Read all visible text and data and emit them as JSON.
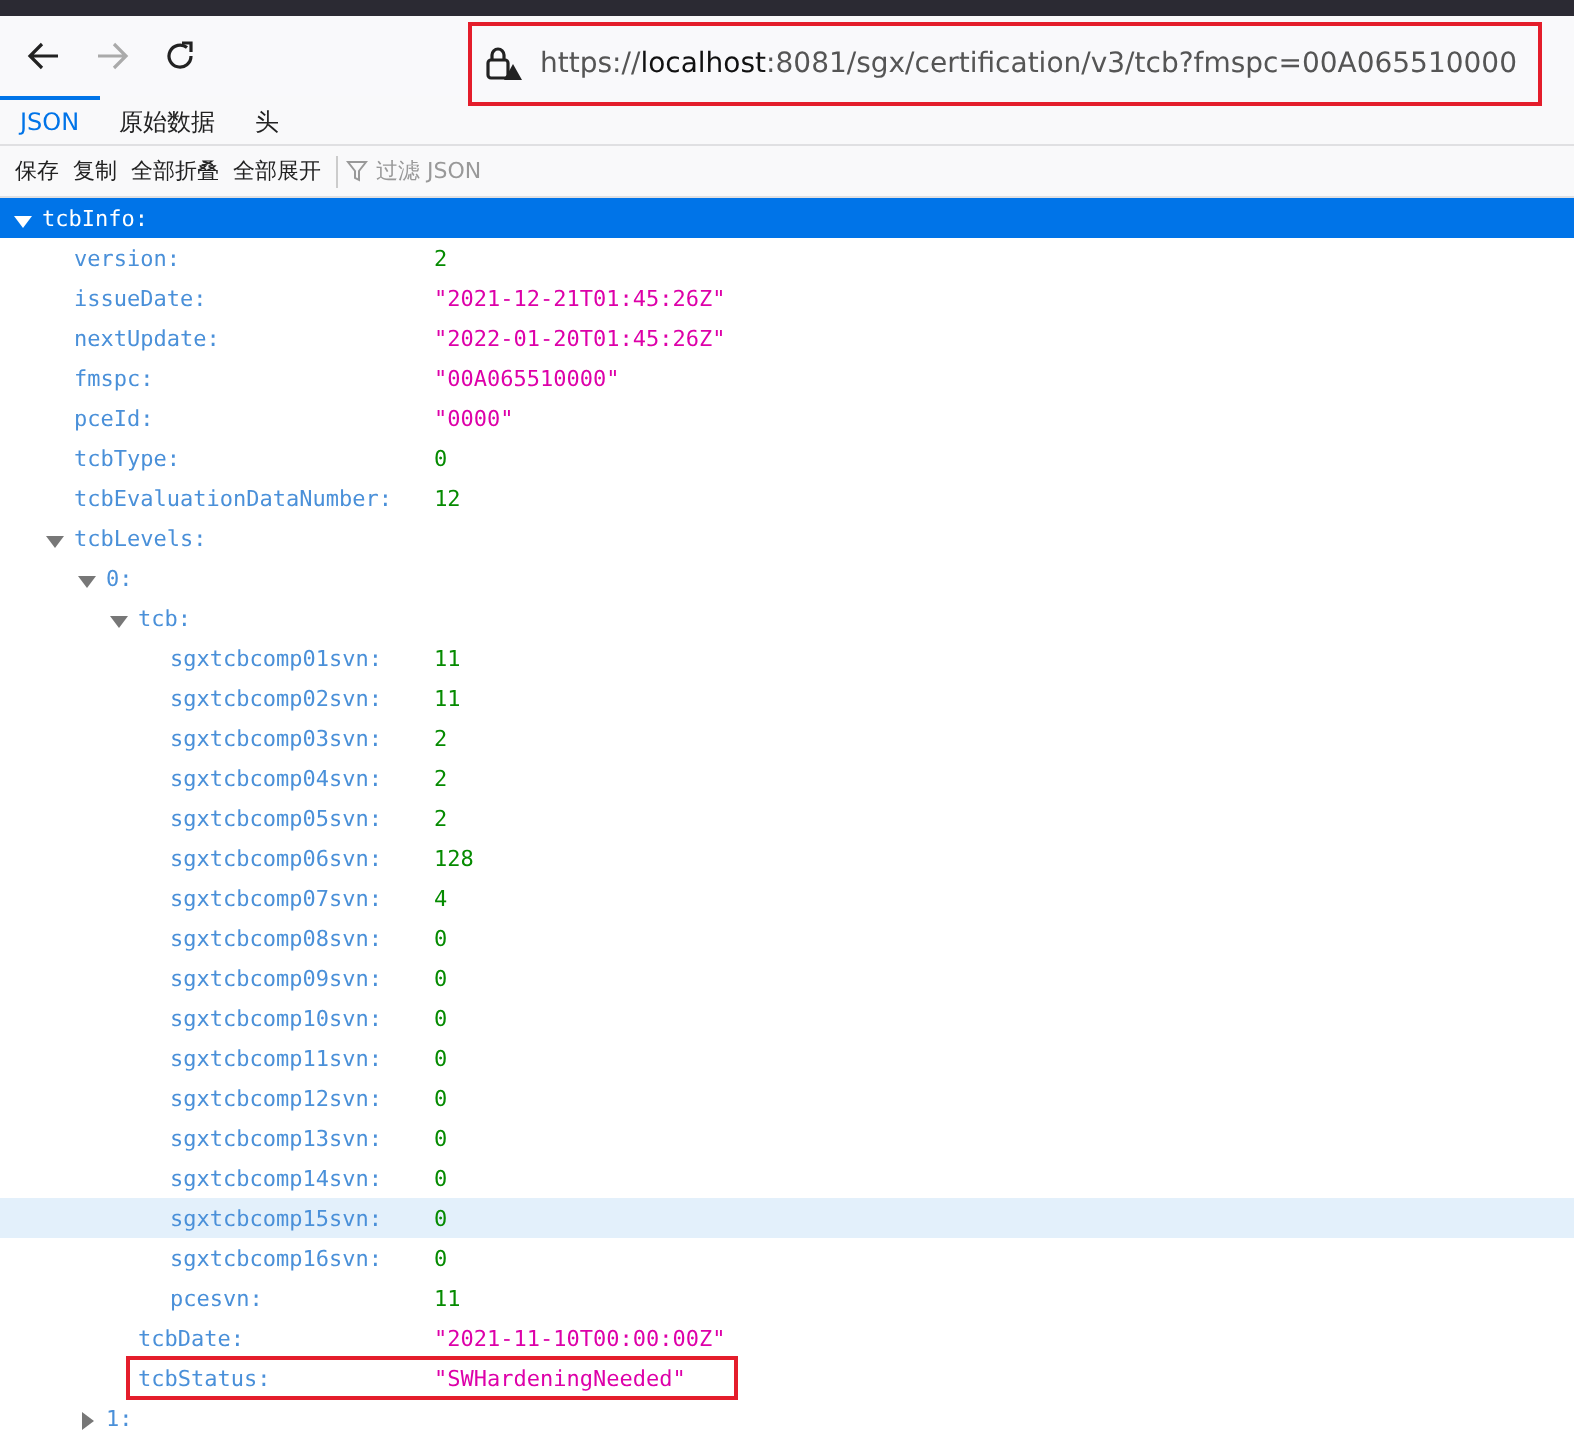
{
  "nav": {
    "back_disabled": false,
    "forward_disabled": true
  },
  "url": {
    "scheme": "https://",
    "host": "localhost",
    "rest": ":8081/sgx/certification/v3/tcb?fmspc=00A065510000",
    "outlined": true
  },
  "tabs": [
    {
      "label": "JSON",
      "selected": true
    },
    {
      "label": "原始数据",
      "selected": false
    },
    {
      "label": "头",
      "selected": false
    }
  ],
  "toolbar": [
    "保存",
    "复制",
    "全部折叠",
    "全部展开"
  ],
  "filter": {
    "placeholder": "过滤 JSON"
  },
  "tree": [
    {
      "key": "tcbInfo:",
      "expanded": true,
      "selected": true,
      "children": [
        {
          "key": "version:",
          "value": "2",
          "kind": "number"
        },
        {
          "key": "issueDate:",
          "value": "\"2021-12-21T01:45:26Z\"",
          "kind": "string"
        },
        {
          "key": "nextUpdate:",
          "value": "\"2022-01-20T01:45:26Z\"",
          "kind": "string"
        },
        {
          "key": "fmspc:",
          "value": "\"00A065510000\"",
          "kind": "string"
        },
        {
          "key": "pceId:",
          "value": "\"0000\"",
          "kind": "string"
        },
        {
          "key": "tcbType:",
          "value": "0",
          "kind": "number"
        },
        {
          "key": "tcbEvaluationDataNumber:",
          "value": "12",
          "kind": "number"
        },
        {
          "key": "tcbLevels:",
          "expanded": true,
          "selected": false,
          "children": [
            {
              "key": "0:",
              "expanded": true,
              "selected": false,
              "children": [
                {
                  "key": "tcb:",
                  "expanded": true,
                  "selected": false,
                  "children": [
                    {
                      "key": "sgxtcbcomp01svn:",
                      "value": "11",
                      "kind": "number",
                      "hovered": false
                    },
                    {
                      "key": "sgxtcbcomp02svn:",
                      "value": "11",
                      "kind": "number",
                      "hovered": false
                    },
                    {
                      "key": "sgxtcbcomp03svn:",
                      "value": "2",
                      "kind": "number",
                      "hovered": false
                    },
                    {
                      "key": "sgxtcbcomp04svn:",
                      "value": "2",
                      "kind": "number",
                      "hovered": false
                    },
                    {
                      "key": "sgxtcbcomp05svn:",
                      "value": "2",
                      "kind": "number",
                      "hovered": false
                    },
                    {
                      "key": "sgxtcbcomp06svn:",
                      "value": "128",
                      "kind": "number",
                      "hovered": false
                    },
                    {
                      "key": "sgxtcbcomp07svn:",
                      "value": "4",
                      "kind": "number",
                      "hovered": false
                    },
                    {
                      "key": "sgxtcbcomp08svn:",
                      "value": "0",
                      "kind": "number",
                      "hovered": false
                    },
                    {
                      "key": "sgxtcbcomp09svn:",
                      "value": "0",
                      "kind": "number",
                      "hovered": false
                    },
                    {
                      "key": "sgxtcbcomp10svn:",
                      "value": "0",
                      "kind": "number",
                      "hovered": false
                    },
                    {
                      "key": "sgxtcbcomp11svn:",
                      "value": "0",
                      "kind": "number",
                      "hovered": false
                    },
                    {
                      "key": "sgxtcbcomp12svn:",
                      "value": "0",
                      "kind": "number",
                      "hovered": false
                    },
                    {
                      "key": "sgxtcbcomp13svn:",
                      "value": "0",
                      "kind": "number",
                      "hovered": false
                    },
                    {
                      "key": "sgxtcbcomp14svn:",
                      "value": "0",
                      "kind": "number",
                      "hovered": false
                    },
                    {
                      "key": "sgxtcbcomp15svn:",
                      "value": "0",
                      "kind": "number",
                      "hovered": true
                    },
                    {
                      "key": "sgxtcbcomp16svn:",
                      "value": "0",
                      "kind": "number",
                      "hovered": false
                    },
                    {
                      "key": "pcesvn:",
                      "value": "11",
                      "kind": "number",
                      "hovered": false
                    }
                  ]
                },
                {
                  "key": "tcbDate:",
                  "value": "\"2021-11-10T00:00:00Z\"",
                  "kind": "string",
                  "outlined": false
                },
                {
                  "key": "tcbStatus:",
                  "value": "\"SWHardeningNeeded\"",
                  "kind": "string",
                  "outlined": true
                }
              ]
            },
            {
              "key": "1:",
              "expanded": false,
              "selected": false
            }
          ]
        }
      ]
    }
  ]
}
